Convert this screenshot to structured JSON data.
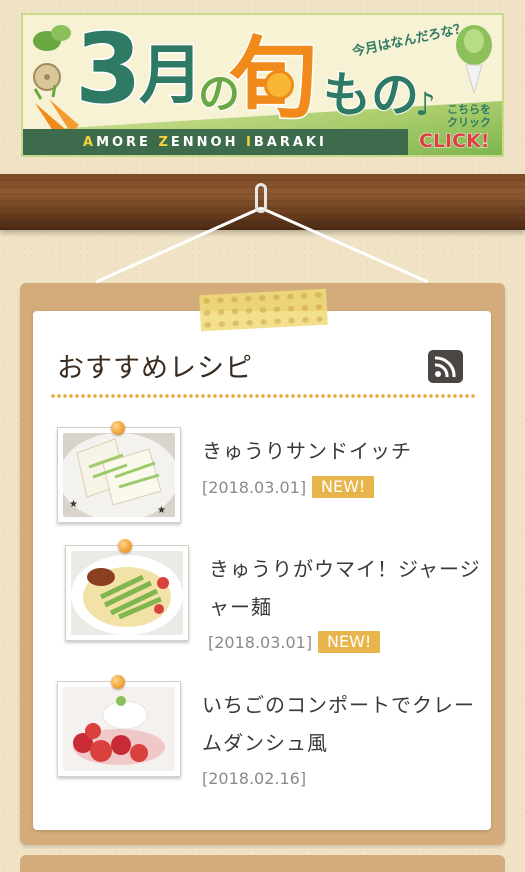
{
  "banner": {
    "digit": "3",
    "month": "月",
    "particle": "の",
    "shun": "旬",
    "mono": "もの",
    "note": "♪",
    "question": "今月はなんだろな？",
    "sub_prefix_a": "A",
    "sub_rest_a": "MORE ",
    "sub_prefix_z": "Z",
    "sub_rest_z": "ENNOH ",
    "sub_prefix_i": "I",
    "sub_rest_i": "BARAKI",
    "click_small_1": "こちらを",
    "click_small_2": "クリック",
    "click_big": "CLICK!"
  },
  "card": {
    "title": "おすすめレシピ",
    "rss_icon": "rss-icon"
  },
  "recipes": [
    {
      "title_line1": "きゅうりサンドイッチ",
      "title_line2": "",
      "date": "[2018.03.01]",
      "badge": "NEW!"
    },
    {
      "title_line1": "きゅうりがウマイ！ジャージ",
      "title_line2": "ャー麺",
      "date": "[2018.03.01]",
      "badge": "NEW!"
    },
    {
      "title_line1": "いちごのコンポートでクレー",
      "title_line2": "ムダンシュ風",
      "date": "[2018.02.16]",
      "badge": ""
    }
  ],
  "colors": {
    "accent_green": "#2f7a64",
    "accent_orange": "#f08a1a",
    "badge": "#e8b54c",
    "board": "#d4ac7c"
  }
}
